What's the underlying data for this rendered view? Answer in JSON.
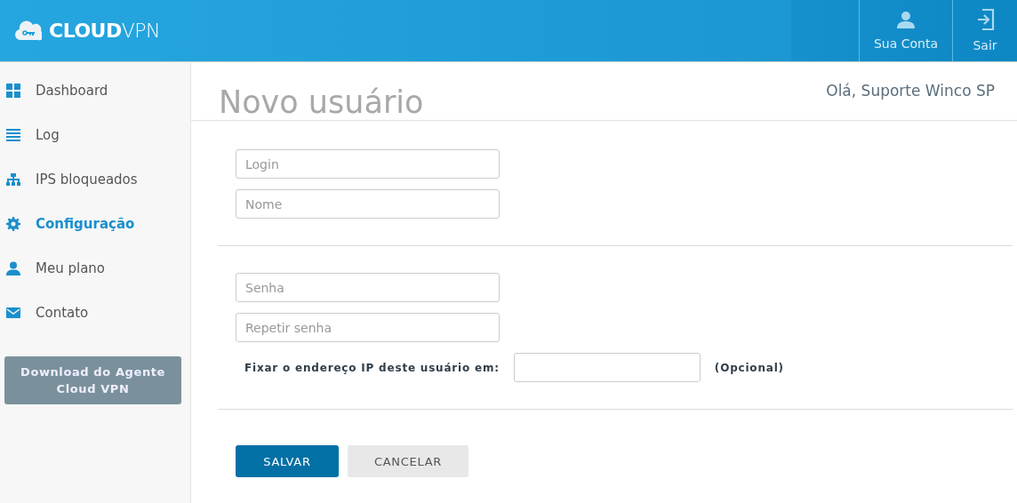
{
  "header": {
    "logo": "**CLOUD**VPN",
    "actions": [
      {
        "label": "Sua Conta"
      },
      {
        "label": "Sair"
      }
    ]
  },
  "sidebar": {
    "items": [
      {
        "label": "Dashboard",
        "selected": false
      },
      {
        "label": "Log",
        "selected": false
      },
      {
        "label": "IPS bloqueados",
        "selected": false
      },
      {
        "label": "Configuração",
        "selected": true
      },
      {
        "label": "Meu plano",
        "selected": false
      },
      {
        "label": "Contato",
        "selected": false
      }
    ],
    "download_button": "Download do Agente Cloud VPN"
  },
  "page": {
    "title": "Novo usuário",
    "greeting": "Olá, Suporte Winco SP"
  },
  "form": {
    "identity_fields": [
      {
        "placeholder": "Login"
      },
      {
        "placeholder": "Nome"
      }
    ],
    "password_fields": [
      {
        "placeholder": "Senha"
      },
      {
        "placeholder": "Repetir senha"
      }
    ],
    "ip_field": {
      "label": "Fixar o endereço IP deste usuário em:",
      "note": "(Opcional)"
    },
    "buttons": [
      {
        "label": "SALVAR",
        "kind": "primary"
      },
      {
        "label": "CANCELAR",
        "kind": "secondary"
      }
    ]
  }
}
